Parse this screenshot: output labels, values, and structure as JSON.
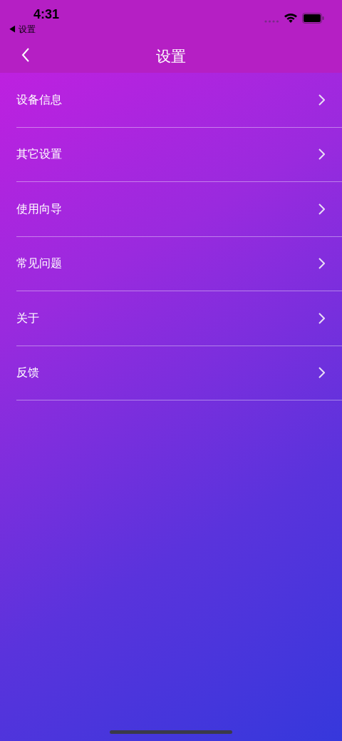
{
  "status_bar": {
    "time": "4:31",
    "back_link": "◀ 设置"
  },
  "nav_bar": {
    "title": "设置"
  },
  "menu_items": [
    {
      "label": "设备信息"
    },
    {
      "label": "其它设置"
    },
    {
      "label": "使用向导"
    },
    {
      "label": "常见问题"
    },
    {
      "label": "关于"
    },
    {
      "label": "反馈"
    }
  ]
}
